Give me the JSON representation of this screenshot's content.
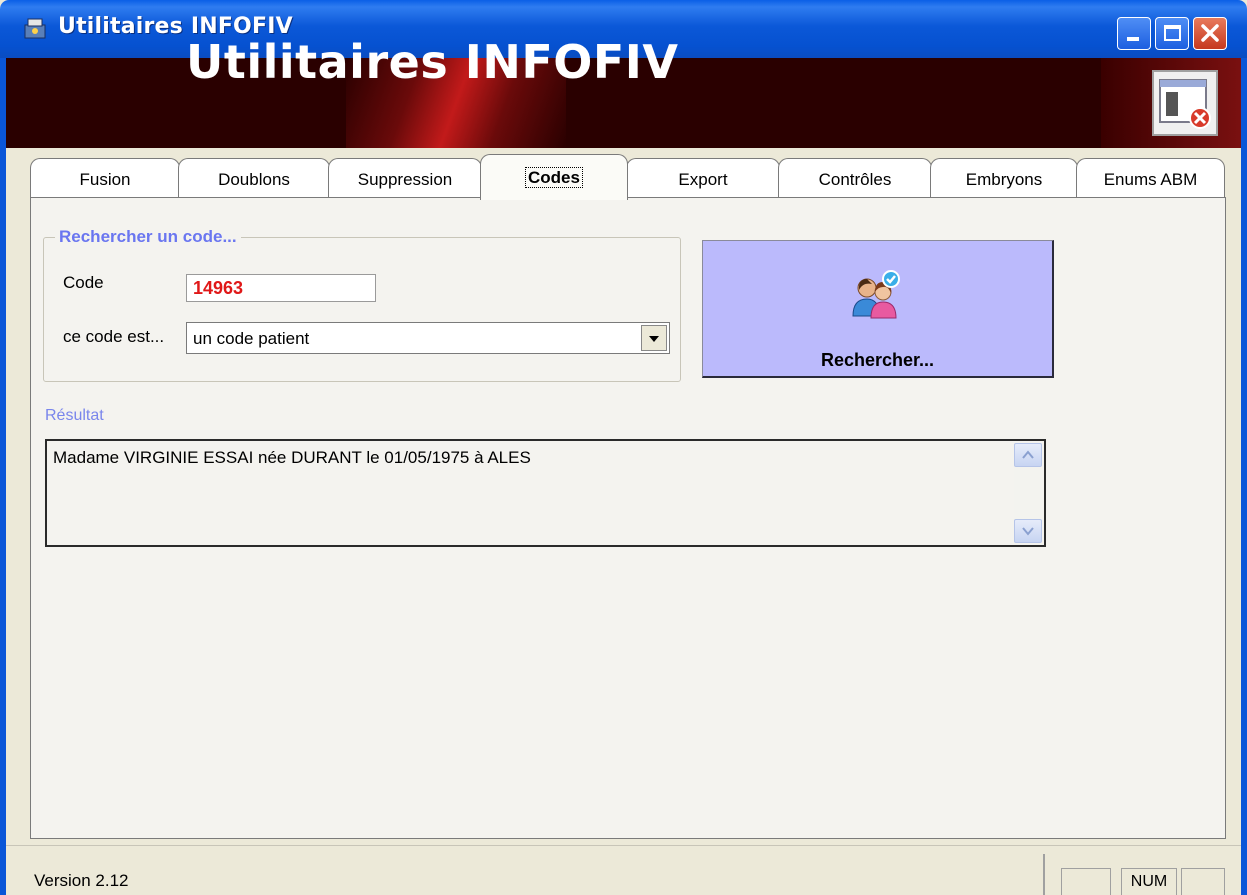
{
  "window": {
    "title": "Utilitaires INFOFIV"
  },
  "banner": {
    "title": "Utilitaires INFOFIV"
  },
  "tabs": [
    {
      "label": "Fusion",
      "active": false
    },
    {
      "label": "Doublons",
      "active": false
    },
    {
      "label": "Suppression",
      "active": false
    },
    {
      "label": "Codes",
      "active": true
    },
    {
      "label": "Export",
      "active": false
    },
    {
      "label": "Contrôles",
      "active": false
    },
    {
      "label": "Embryons",
      "active": false
    },
    {
      "label": "Enums ABM",
      "active": false
    }
  ],
  "search_group": {
    "title": "Rechercher un code...",
    "code_label": "Code",
    "code_value": "14963",
    "type_label": "ce code est...",
    "type_value": "un code patient"
  },
  "search_button": {
    "label": "Rechercher..."
  },
  "result": {
    "label": "Résultat",
    "text": "Madame VIRGINIE ESSAI née DURANT le 01/05/1975 à ALES"
  },
  "status": {
    "version": "Version 2.12",
    "num": "NUM"
  },
  "colors": {
    "titlebar": "#0a5fe6",
    "banner_bg": "#2a0000",
    "accent_label": "#6a76f0",
    "code_value": "#e01818",
    "search_button_bg": "#bbbafc"
  },
  "icons": {
    "app": "app-icon",
    "exit": "exit-app-icon",
    "search_button": "users-check-icon"
  }
}
